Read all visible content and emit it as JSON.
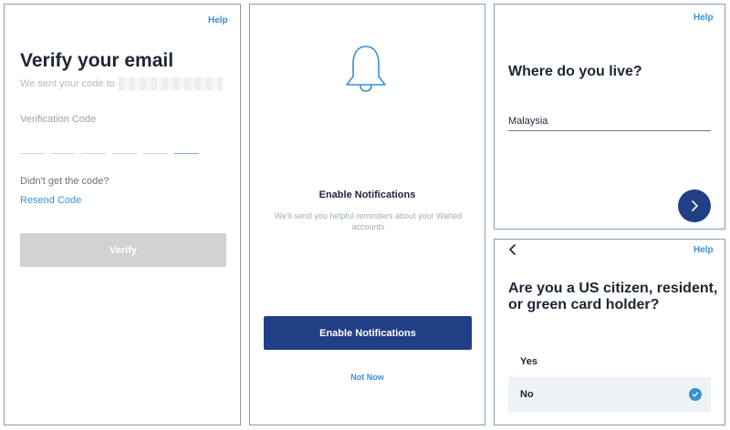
{
  "verify_screen": {
    "help": "Help",
    "title": "Verify your email",
    "subtitle": "We sent your code to",
    "code_label": "Verification Code",
    "code_digits": 6,
    "resend_prompt": "Didn't get the code?",
    "resend_link": "Resend Code",
    "verify_button": "Verify"
  },
  "notifications_screen": {
    "icon": "bell-icon",
    "title": "Enable Notifications",
    "description": "We'll send you helpful reminders about your Wahed accounts",
    "enable_button": "Enable Notifications",
    "not_now_link": "Not Now"
  },
  "residence_screen": {
    "help": "Help",
    "question": "Where do you live?",
    "country_value": "Malaysia",
    "next_icon": "chevron-right-icon"
  },
  "citizenship_screen": {
    "help": "Help",
    "back_icon": "chevron-left-icon",
    "question": "Are you a US citizen, resident, or green card holder?",
    "options": [
      {
        "label": "Yes",
        "selected": false
      },
      {
        "label": "No",
        "selected": true
      }
    ]
  },
  "colors": {
    "primary": "#213f85",
    "accent": "#3a8fd3",
    "disabled": "#d2d2d2",
    "text": "#1d2535"
  }
}
